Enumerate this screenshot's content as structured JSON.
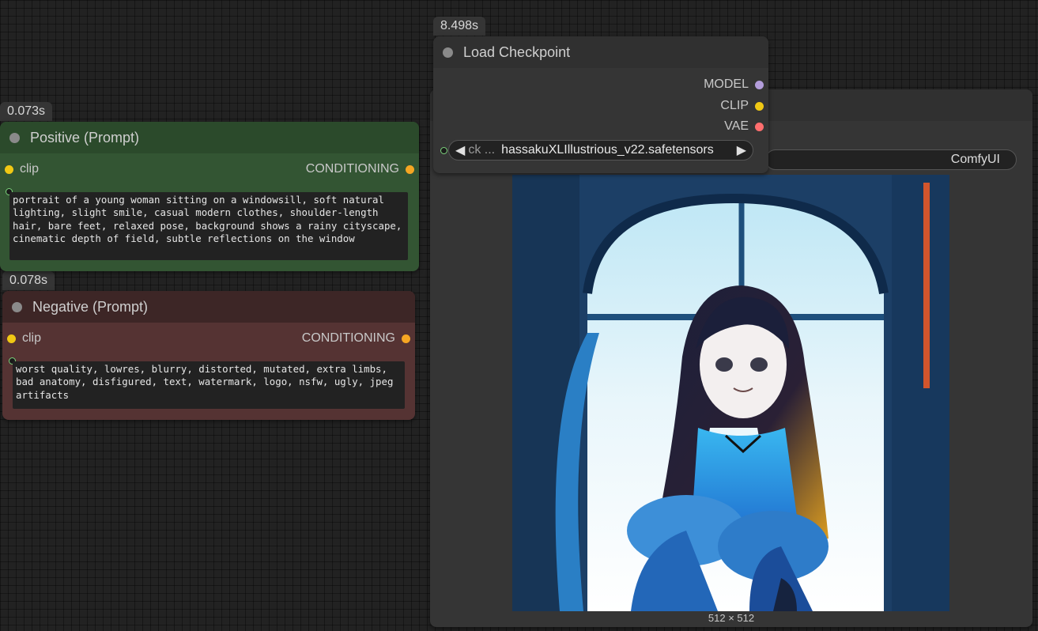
{
  "timings": {
    "checkpoint": "8.498s",
    "positive": "0.073s",
    "negative": "0.078s"
  },
  "checkpoint": {
    "title": "Load Checkpoint",
    "outputs": [
      "MODEL",
      "CLIP",
      "VAE"
    ],
    "ckpt_label": "ck ...",
    "ckpt_value": "hassakuXLIllustrious_v22.safetensors",
    "prev_arrow": "◀",
    "next_arrow": "▶"
  },
  "positive": {
    "title": "Positive (Prompt)",
    "input": "clip",
    "output": "CONDITIONING",
    "text": "portrait of a young woman sitting on a windowsill, soft natural lighting, slight smile, casual modern clothes, shoulder-length hair, bare feet, relaxed pose, background shows a rainy cityscape, cinematic depth of field, subtle reflections on the window"
  },
  "negative": {
    "title": "Negative (Prompt)",
    "input": "clip",
    "output": "CONDITIONING",
    "text": "worst quality, lowres, blurry, distorted, mutated, extra limbs, bad anatomy, disfigured, text, watermark, logo, nsfw, ugly, jpeg artifacts"
  },
  "preview": {
    "filename_prefix": "ComfyUI",
    "image_size": "512 × 512"
  },
  "colors": {
    "clip_socket": "#f0c814",
    "conditioning_socket": "#f5a623",
    "model_socket": "#b39ddb",
    "vae_socket": "#ff6e6e",
    "positive_node": "#335533",
    "negative_node": "#553333"
  }
}
